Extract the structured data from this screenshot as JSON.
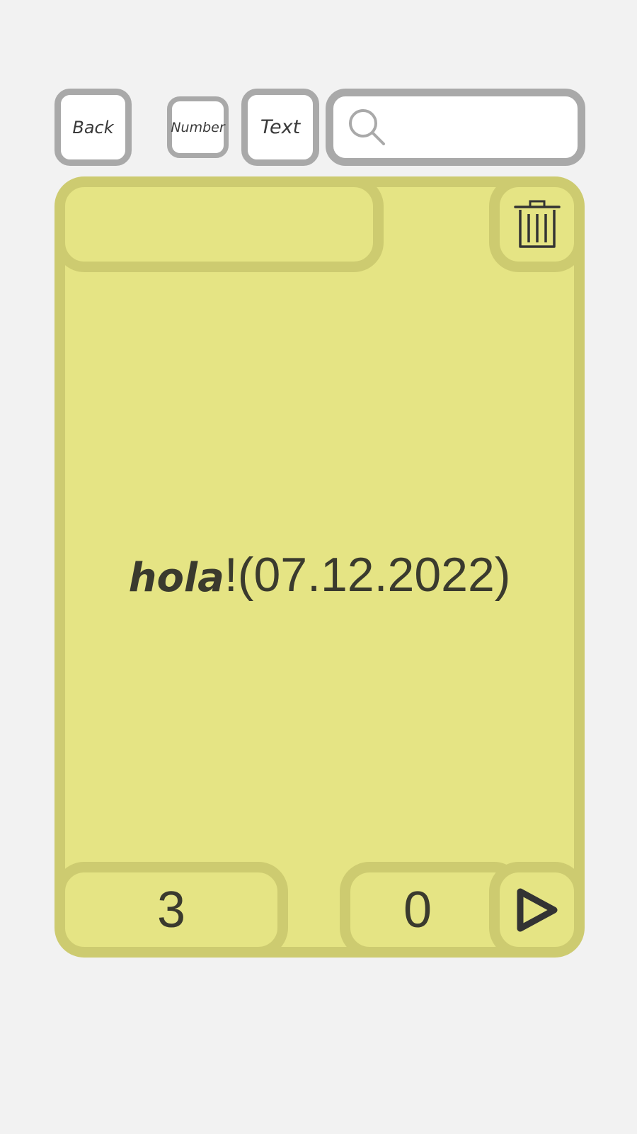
{
  "toolbar": {
    "back_label": "Back",
    "number_label": "Number",
    "text_label": "Text",
    "search": {
      "icon": "search-icon",
      "value": "",
      "placeholder": ""
    }
  },
  "card": {
    "title_value": "",
    "delete_icon": "trash-icon",
    "content_word": "hola",
    "content_rest": "!(07.12.2022)",
    "counter_left": "3",
    "counter_right": "0",
    "play_icon": "play-icon"
  },
  "colors": {
    "background": "#f2f2f2",
    "card_fill": "#e5e484",
    "card_border": "#cdcb70",
    "button_border": "#a9a9a9",
    "text": "#3a3a2e"
  }
}
